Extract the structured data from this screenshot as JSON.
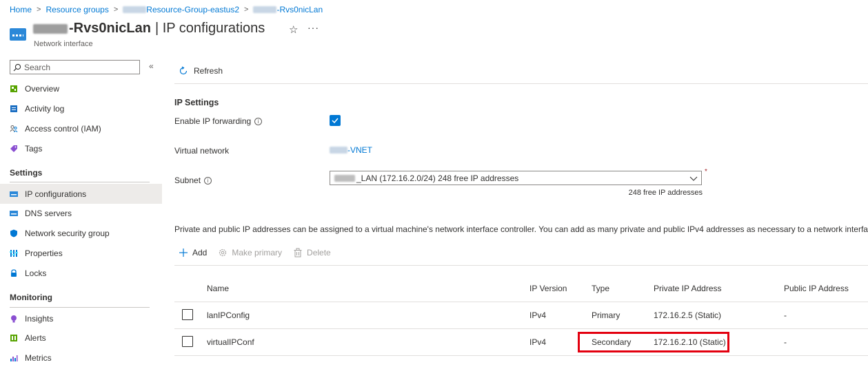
{
  "breadcrumb": {
    "home": "Home",
    "resource_groups": "Resource groups",
    "resource_group": "Resource-Group-eastus2",
    "nic": "-Rvs0nicLan"
  },
  "header": {
    "name_suffix": "-Rvs0nicLan",
    "section": "| IP configurations",
    "subtitle": "Network interface"
  },
  "sidebar": {
    "search_placeholder": "Search",
    "items": [
      {
        "label": "Overview"
      },
      {
        "label": "Activity log"
      },
      {
        "label": "Access control (IAM)"
      },
      {
        "label": "Tags"
      }
    ],
    "settings_heading": "Settings",
    "settings_items": [
      {
        "label": "IP configurations"
      },
      {
        "label": "DNS servers"
      },
      {
        "label": "Network security group"
      },
      {
        "label": "Properties"
      },
      {
        "label": "Locks"
      }
    ],
    "monitoring_heading": "Monitoring",
    "monitoring_items": [
      {
        "label": "Insights"
      },
      {
        "label": "Alerts"
      },
      {
        "label": "Metrics"
      }
    ]
  },
  "commands": {
    "refresh": "Refresh"
  },
  "ip_settings": {
    "heading": "IP Settings",
    "forwarding_label": "Enable IP forwarding",
    "forwarding_checked": true,
    "vnet_label": "Virtual network",
    "vnet_value": "-VNET",
    "subnet_label": "Subnet",
    "subnet_value": "_LAN (172.16.2.0/24) 248 free IP addresses",
    "subnet_hint": "248 free IP addresses",
    "required_mark": "*"
  },
  "description": "Private and public IP addresses can be assigned to a virtual machine's network interface controller. You can add as many private and public IPv4 addresses as necessary to a network interface, withi",
  "toolbar": {
    "add": "Add",
    "make_primary": "Make primary",
    "delete": "Delete"
  },
  "table": {
    "columns": [
      "Name",
      "IP Version",
      "Type",
      "Private IP Address",
      "Public IP Address"
    ],
    "rows": [
      {
        "name": "lanIPConfig",
        "version": "IPv4",
        "type": "Primary",
        "private_ip": "172.16.2.5 (Static)",
        "public_ip": "-"
      },
      {
        "name": "virtualIPConf",
        "version": "IPv4",
        "type": "Secondary",
        "private_ip": "172.16.2.10 (Static)",
        "public_ip": "-"
      }
    ]
  },
  "colors": {
    "accent": "#0078d4",
    "highlight": "#e3000f"
  }
}
